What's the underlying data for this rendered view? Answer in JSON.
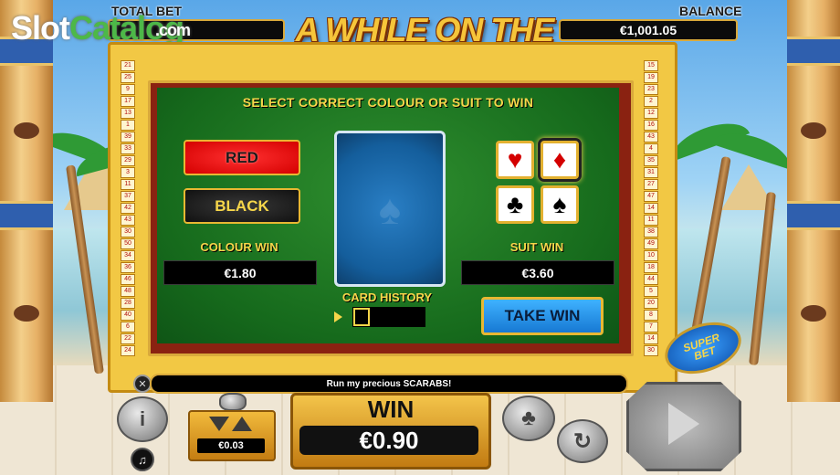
{
  "header": {
    "total_bet_label": "TOTAL BET",
    "balance_label": "BALANCE",
    "balance_value": "€1,001.05",
    "game_title": "A WHILE ON THE NILE",
    "trademark": "™"
  },
  "watermark": {
    "part1": "Slot",
    "part2": "Catalog",
    "suffix": ".com"
  },
  "paylines": {
    "left": [
      "21",
      "25",
      "9",
      "17",
      "13",
      "1",
      "39",
      "33",
      "29",
      "3",
      "11",
      "37",
      "42",
      "43",
      "30",
      "50",
      "34",
      "36",
      "46",
      "48",
      "28",
      "40",
      "6",
      "22",
      "24"
    ],
    "right": [
      "15",
      "19",
      "23",
      "2",
      "12",
      "16",
      "43",
      "4",
      "35",
      "31",
      "27",
      "47",
      "14",
      "11",
      "38",
      "49",
      "10",
      "18",
      "44",
      "5",
      "20",
      "8",
      "7",
      "14",
      "30"
    ]
  },
  "gamble": {
    "heading": "SELECT CORRECT COLOUR OR SUIT TO WIN",
    "red_label": "RED",
    "black_label": "BLACK",
    "colour_win_label": "COLOUR WIN",
    "colour_win_value": "€1.80",
    "suit_win_label": "SUIT WIN",
    "suit_win_value": "€3.60",
    "card_history_label": "CARD HISTORY",
    "take_win_label": "TAKE WIN",
    "card_back_symbol": "♠",
    "suits": {
      "hearts": "♥",
      "diamonds": "♦",
      "clubs": "♣",
      "spades": "♠"
    }
  },
  "message": "Run my precious SCARABS!",
  "close_symbol": "✕",
  "controls": {
    "bet_value": "€0.03",
    "win_label": "WIN",
    "win_value": "€0.90",
    "info_symbol": "i",
    "sound_symbol": "♫",
    "gamble_symbol": "♣",
    "autoplay_symbol": "↻"
  },
  "superbet": {
    "line1": "SUPER",
    "line2": "BET"
  },
  "colors": {
    "gold": "#d9a93b",
    "felt": "#166a1c",
    "red_button": "#d40000",
    "take_win": "#1779d3"
  }
}
